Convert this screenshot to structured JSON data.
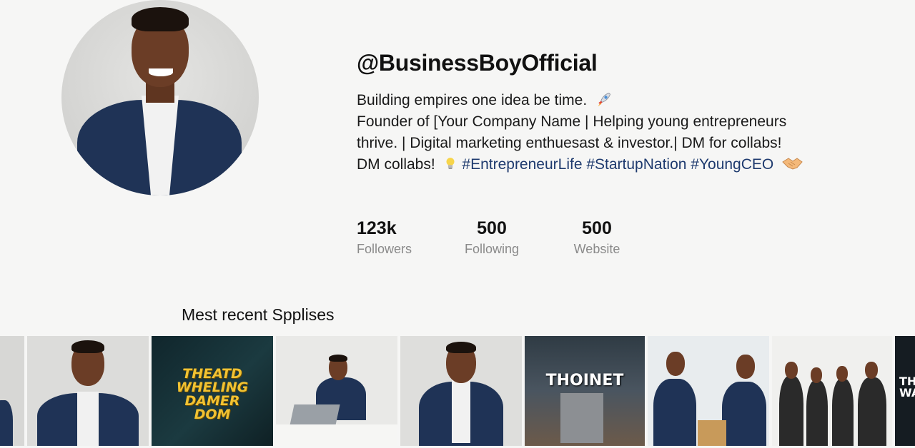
{
  "profile": {
    "username": "@BusinessBoyOfficial",
    "bio_lines": [
      "Building empires one idea be time.",
      "Founder of [Your Company Name | Helping young entrepreneurs",
      "thrive. | Digital marketing enthuesast & investor.| DM for collabs!",
      "DM collabs!"
    ],
    "hashtags": "#EntrepreneurLife #StartupNation #YoungCEO",
    "icons": [
      "rocket-icon",
      "lightbulb-icon",
      "handshake-icon"
    ]
  },
  "stats": [
    {
      "value": "123k",
      "label": "Followers"
    },
    {
      "value": "500",
      "label": "Following"
    },
    {
      "value": "500",
      "label": "Website"
    }
  ],
  "recent": {
    "title": "Mest recent Spplises",
    "tiles": [
      {
        "text": ""
      },
      {
        "text": ""
      },
      {
        "text": "THEATD\nWHELING\nDAMER\nDOM"
      },
      {
        "text": ""
      },
      {
        "text": ""
      },
      {
        "text": "THOINET"
      },
      {
        "text": ""
      },
      {
        "text": ""
      },
      {
        "text": "TH\nWA"
      }
    ]
  },
  "colors": {
    "background": "#f6f6f5",
    "hashtag": "#1e3a6e",
    "muted": "#8a8a8a",
    "suit": "#1f3356"
  }
}
